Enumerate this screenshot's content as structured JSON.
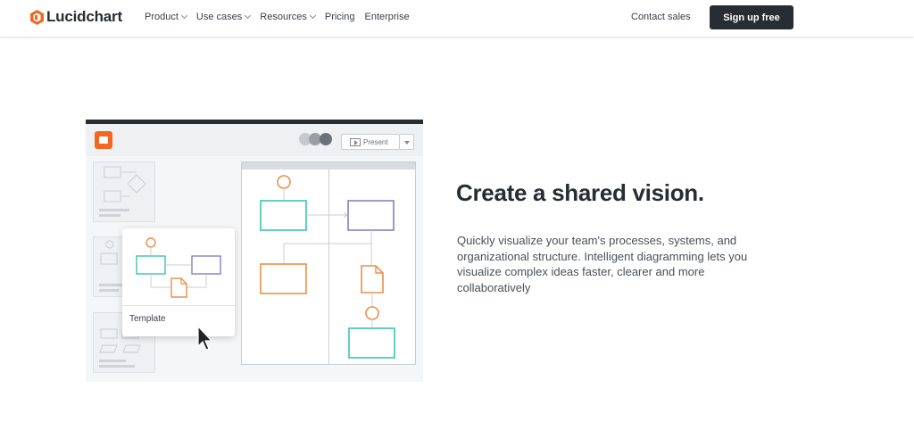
{
  "header": {
    "logo_text": "Lucidchart",
    "nav": [
      {
        "label": "Product",
        "has_dropdown": true
      },
      {
        "label": "Use cases",
        "has_dropdown": true
      },
      {
        "label": "Resources",
        "has_dropdown": true
      },
      {
        "label": "Pricing",
        "has_dropdown": false
      },
      {
        "label": "Enterprise",
        "has_dropdown": false
      }
    ],
    "contact_label": "Contact sales",
    "signup_label": "Sign up free"
  },
  "illustration": {
    "present_label": "Present",
    "template_label": "Template",
    "colors": {
      "orange": "#e8904a",
      "teal": "#3cc3b0",
      "purple": "#8a7cc6",
      "brand_orange": "#f26722"
    }
  },
  "hero": {
    "headline": "Create a shared vision.",
    "body": "Quickly visualize your team's processes, systems, and organizational structure. Intelligent diagramming lets you visualize complex ideas faster, clearer and more collaboratively"
  }
}
